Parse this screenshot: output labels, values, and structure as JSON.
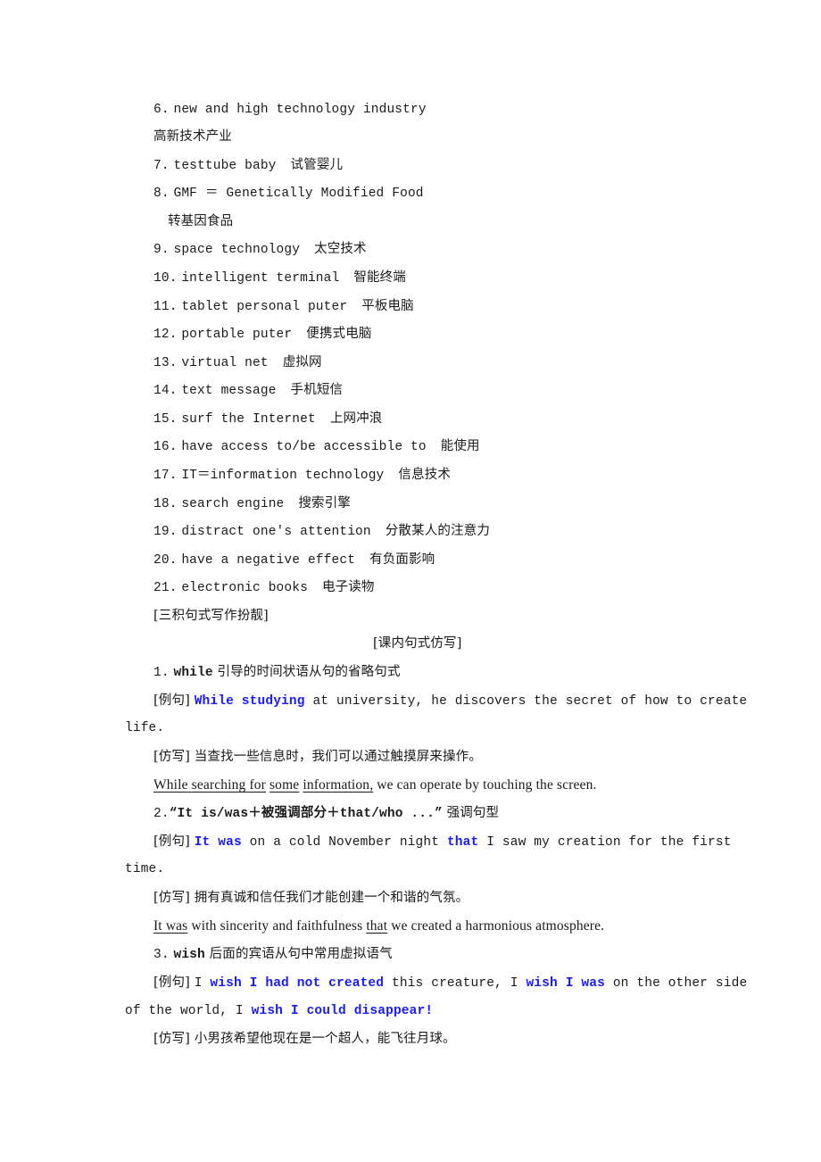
{
  "vocab": [
    {
      "num": "6.",
      "en": "new and high technology industry",
      "cn": "高新技术产业",
      "cn_wrap": true
    },
    {
      "num": "7.",
      "en": "testtube baby",
      "cn": "试管婴儿"
    },
    {
      "num": "8.",
      "en": "GMF ＝ Genetically Modified Food",
      "cn": "转基因食品",
      "cn_wrap": true
    },
    {
      "num": "9.",
      "en": "space technology",
      "cn": "太空技术"
    },
    {
      "num": "10.",
      "en": "intelligent terminal",
      "cn": "智能终端"
    },
    {
      "num": "11.",
      "en": "tablet personal puter",
      "cn": "平板电脑"
    },
    {
      "num": "12.",
      "en": "portable puter",
      "cn": "便携式电脑"
    },
    {
      "num": "13.",
      "en": "virtual net",
      "cn": "虚拟网"
    },
    {
      "num": "14.",
      "en": "text message",
      "cn": "手机短信"
    },
    {
      "num": "15.",
      "en": "surf the Internet",
      "cn": "上网冲浪"
    },
    {
      "num": "16.",
      "en": "have access to/be accessible to",
      "cn": "能使用"
    },
    {
      "num": "17.",
      "en": "IT＝information technology",
      "cn": "信息技术"
    },
    {
      "num": "18.",
      "en": "search engine",
      "cn": "搜索引擎"
    },
    {
      "num": "19.",
      "en": "distract one's attention",
      "cn": "分散某人的注意力"
    },
    {
      "num": "20.",
      "en": "have a negative effect",
      "cn": "有负面影响"
    },
    {
      "num": "21.",
      "en": "electronic books",
      "cn": "电子读物"
    }
  ],
  "section_heading": "[三积句式写作扮靓]",
  "subsection_heading": "[课内句式仿写]",
  "patterns": [
    {
      "title_num": "1.",
      "title_key": "while",
      "title_rest": "引导的时间状语从句的省略句式",
      "example_label": "[例句]",
      "example_line1": [
        {
          "text": "While studying",
          "style": "blue"
        },
        {
          "text": " at university, he discovers the secret of how to create",
          "style": "plain"
        }
      ],
      "example_line2": "life.",
      "imitate_label": "[仿写]",
      "imitate_prompt": "当查找一些信息时，我们可以通过触摸屏来操作。",
      "answer": [
        {
          "text": "While",
          "style": "ul"
        },
        {
          "text": " ",
          "style": "ul"
        },
        {
          "text": "searching",
          "style": "ul"
        },
        {
          "text": " ",
          "style": "ul"
        },
        {
          "text": "for",
          "style": "ul"
        },
        {
          "text": " ",
          "style": "plain"
        },
        {
          "text": "some",
          "style": "ul"
        },
        {
          "text": " ",
          "style": "plain"
        },
        {
          "text": "information,",
          "style": "ul"
        },
        {
          "text": " we can operate by touching the screen.",
          "style": "plain"
        }
      ]
    },
    {
      "title_num": "2.",
      "title_key": "“It is/was＋被强调部分＋that/who ...”",
      "title_rest": "强调句型",
      "example_label": "[例句]",
      "example_line1": [
        {
          "text": "It was",
          "style": "blue"
        },
        {
          "text": " on a cold November night ",
          "style": "plain"
        },
        {
          "text": "that",
          "style": "blue"
        },
        {
          "text": " I saw my creation for the first",
          "style": "plain"
        }
      ],
      "example_line2": "time.",
      "imitate_label": "[仿写]",
      "imitate_prompt": "拥有真诚和信任我们才能创建一个和谐的气氛。",
      "answer": [
        {
          "text": "It",
          "style": "ul"
        },
        {
          "text": " ",
          "style": "ul"
        },
        {
          "text": "was",
          "style": "ul"
        },
        {
          "text": " with sincerity and faithfulness ",
          "style": "plain"
        },
        {
          "text": "that",
          "style": "ul"
        },
        {
          "text": " we created a harmonious atmosphere.",
          "style": "plain"
        }
      ]
    },
    {
      "title_num": "3.",
      "title_key": "wish",
      "title_rest": "后面的宾语从句中常用虚拟语气",
      "example_label": "[例句]",
      "example_line1": [
        {
          "text": "I ",
          "style": "plain"
        },
        {
          "text": "wish I had not created",
          "style": "blue"
        },
        {
          "text": " this creature, I ",
          "style": "plain"
        },
        {
          "text": "wish I was",
          "style": "blue"
        },
        {
          "text": " on the other side",
          "style": "plain"
        }
      ],
      "example_line2_parts": [
        {
          "text": "of the world, I ",
          "style": "plain"
        },
        {
          "text": "wish I could disappear!",
          "style": "blue"
        }
      ],
      "imitate_label": "[仿写]",
      "imitate_prompt": "小男孩希望他现在是一个超人，能飞往月球。"
    }
  ]
}
